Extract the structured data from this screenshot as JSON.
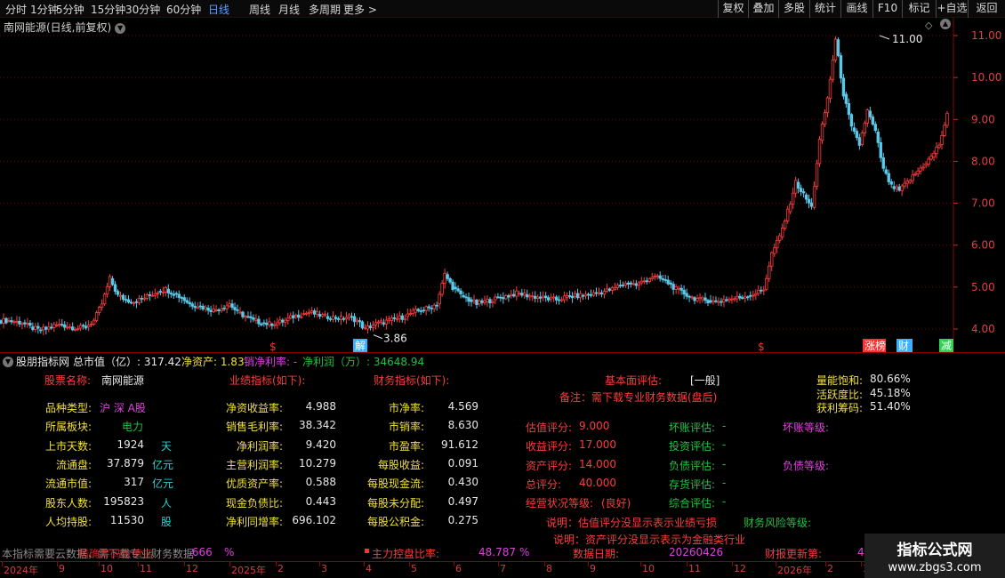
{
  "toolbar": {
    "left": [
      "分时",
      "1分钟",
      "5分钟",
      "15分钟",
      "30分钟",
      "60分钟",
      "日线",
      "周线",
      "月线",
      "多周期",
      "更多 >"
    ],
    "right": [
      "复权",
      "叠加",
      "多股",
      "统计",
      "画线",
      "F10",
      "标记",
      "+自选",
      "返回"
    ]
  },
  "chart": {
    "title": "南网能源(日线,前复权)",
    "y_labels": [
      "11.00",
      "10.00",
      "9.00",
      "8.00",
      "7.00",
      "6.00",
      "5.00",
      "4.00"
    ],
    "high_label": "11.00",
    "low_label": "3.86",
    "markers": [
      {
        "text": "$",
        "color": "#ff3030"
      },
      {
        "text": "解",
        "color": "#3ab0ff"
      },
      {
        "text": "$",
        "color": "#ff3030"
      },
      {
        "text": "涨榜",
        "color": "#ff3030"
      },
      {
        "text": "财",
        "color": "#3ab0ff"
      },
      {
        "text": "减",
        "color": "#30d050"
      }
    ]
  },
  "chart_data": {
    "type": "candlestick",
    "title": "南网能源(日线,前复权)",
    "ylim": [
      3.86,
      11.0
    ],
    "y_ticks": [
      4,
      5,
      6,
      7,
      8,
      9,
      10,
      11
    ],
    "high": 11.0,
    "low": 3.86,
    "close_path": [
      4.2,
      4.18,
      4.15,
      4.05,
      3.98,
      4.0,
      4.08,
      4.1,
      4.05,
      4.02,
      4.05,
      4.2,
      4.6,
      5.2,
      4.8,
      4.7,
      4.65,
      4.72,
      4.8,
      4.9,
      4.95,
      4.85,
      4.75,
      4.6,
      4.55,
      4.5,
      4.45,
      4.5,
      4.6,
      4.4,
      4.3,
      4.2,
      4.15,
      4.12,
      4.15,
      4.2,
      4.3,
      4.35,
      4.4,
      4.35,
      4.3,
      4.28,
      4.25,
      4.3,
      4.2,
      4.0,
      4.1,
      4.15,
      4.2,
      4.25,
      4.3,
      4.4,
      4.45,
      4.5,
      4.6,
      5.3,
      5.0,
      4.8,
      4.7,
      4.6,
      4.65,
      4.7,
      4.75,
      4.8,
      4.85,
      4.82,
      4.78,
      4.75,
      4.72,
      4.7,
      4.75,
      4.78,
      4.8,
      4.82,
      4.85,
      4.9,
      4.95,
      5.05,
      5.1,
      5.05,
      5.15,
      5.25,
      5.2,
      5.1,
      4.95,
      4.85,
      4.75,
      4.7,
      4.68,
      4.65,
      4.7,
      4.72,
      4.75,
      4.8,
      4.85,
      4.95,
      5.8,
      6.2,
      6.8,
      7.5,
      7.2,
      6.9,
      8.5,
      9.5,
      10.9,
      9.6,
      8.8,
      8.4,
      9.2,
      8.7,
      7.8,
      7.4,
      7.3,
      7.5,
      7.7,
      7.9,
      8.1,
      8.4,
      9.1
    ]
  },
  "panel": {
    "header": [
      {
        "text": "股朋指标网",
        "color": "#e8e8e8"
      },
      {
        "text": "总市值（亿）: 317.42",
        "color": "#e8e8e8"
      },
      {
        "text": "净资产: 1.83",
        "color": "#f0e040"
      },
      {
        "text": "销净利率: -",
        "color": "#e040e0"
      },
      {
        "text": "净利润（万）: 34648.94",
        "color": "#22c040"
      }
    ],
    "col1": {
      "title_label": "股票名称:",
      "title_value": "南网能源",
      "rows": [
        {
          "label": "品种类型:",
          "value": "沪 深 A股",
          "unit": ""
        },
        {
          "label": "所属板块:",
          "value": "电力",
          "unit": ""
        },
        {
          "label": "上市天数:",
          "value": "1924",
          "unit": "天"
        },
        {
          "label": "流通盘:",
          "value": "37.879",
          "unit": "亿元"
        },
        {
          "label": "流通市值:",
          "value": "317",
          "unit": "亿元"
        },
        {
          "label": "股东人数:",
          "value": "195823",
          "unit": "人"
        },
        {
          "label": "人均持股:",
          "value": "11530",
          "unit": "股"
        }
      ]
    },
    "col2": {
      "title": "业绩指标(如下):",
      "rows": [
        {
          "label": "净资收益率:",
          "value": "4.988"
        },
        {
          "label": "销售毛利率:",
          "value": "38.342"
        },
        {
          "label": "净利润率:",
          "value": "9.420"
        },
        {
          "label": "主营利润率:",
          "value": "10.279"
        },
        {
          "label": "优质资产率:",
          "value": "0.588"
        },
        {
          "label": "现金负债比:",
          "value": "0.443"
        },
        {
          "label": "净利同增率:",
          "value": "696.102"
        }
      ]
    },
    "col3": {
      "title": "财务指标(如下):",
      "rows": [
        {
          "label": "市净率:",
          "value": "4.569"
        },
        {
          "label": "市销率:",
          "value": "8.630"
        },
        {
          "label": "市盈率:",
          "value": "91.612"
        },
        {
          "label": "每股收益:",
          "value": "0.091"
        },
        {
          "label": "每股现金流:",
          "value": "0.430"
        },
        {
          "label": "每股未分配:",
          "value": "0.497"
        },
        {
          "label": "每股公积金:",
          "value": "0.275"
        }
      ]
    },
    "fundamental": {
      "label": "基本面评估:",
      "value": "[一般]",
      "note": "备注：需下载专业财务数据(盘后)"
    },
    "scores": [
      {
        "label": "估值评分:",
        "value": "9.000"
      },
      {
        "label": "收益评分:",
        "value": "17.000"
      },
      {
        "label": "资产评分:",
        "value": "14.000"
      },
      {
        "label": "总评分:",
        "value": "40.000"
      },
      {
        "label": "经营状况等级:",
        "value": "(良好)"
      }
    ],
    "evals": [
      {
        "label": "坏账评估:",
        "value": "-"
      },
      {
        "label": "投资评估:",
        "value": "-"
      },
      {
        "label": "负债评估:",
        "value": "-"
      },
      {
        "label": "存货评估:",
        "value": "-"
      },
      {
        "label": "综合评估:",
        "value": "-"
      }
    ],
    "grades": [
      {
        "label": "坏账等级:"
      },
      {
        "label": "负债等级:"
      }
    ],
    "notes": [
      "说明：估值评分没显示表示业绩亏损",
      "说明：资产评分没显示表示为金融类行业"
    ],
    "risk_label": "财务风险等级:",
    "volume": [
      {
        "label": "量能饱和:",
        "value": "80.66%"
      },
      {
        "label": "活跃度比:",
        "value": "45.18%"
      },
      {
        "label": "获利筹码:",
        "value": "51.40%"
      }
    ],
    "footer": {
      "hint": "本指标需要云数据，需下载专业财务数据",
      "overlay": "精确筹码数值指",
      "pct1": ".666",
      "pct1_unit": "%",
      "ctrl_label": "主力控盘比率:",
      "ctrl_value": "48.787",
      "ctrl_unit": "%",
      "date_label": "数据日期:",
      "date_value": "20260426",
      "report_label": "财报更新第:",
      "report_value": "4"
    }
  },
  "date_axis": [
    "2024年",
    "9",
    "10",
    "11",
    "12",
    "2025年",
    "2",
    "3",
    "4",
    "5",
    "6",
    "7",
    "8",
    "9",
    "10",
    "11",
    "12",
    "2026年",
    "2",
    "3"
  ],
  "watermark": {
    "line1": "指标公式网",
    "line2": "www.zbgs3.com"
  }
}
